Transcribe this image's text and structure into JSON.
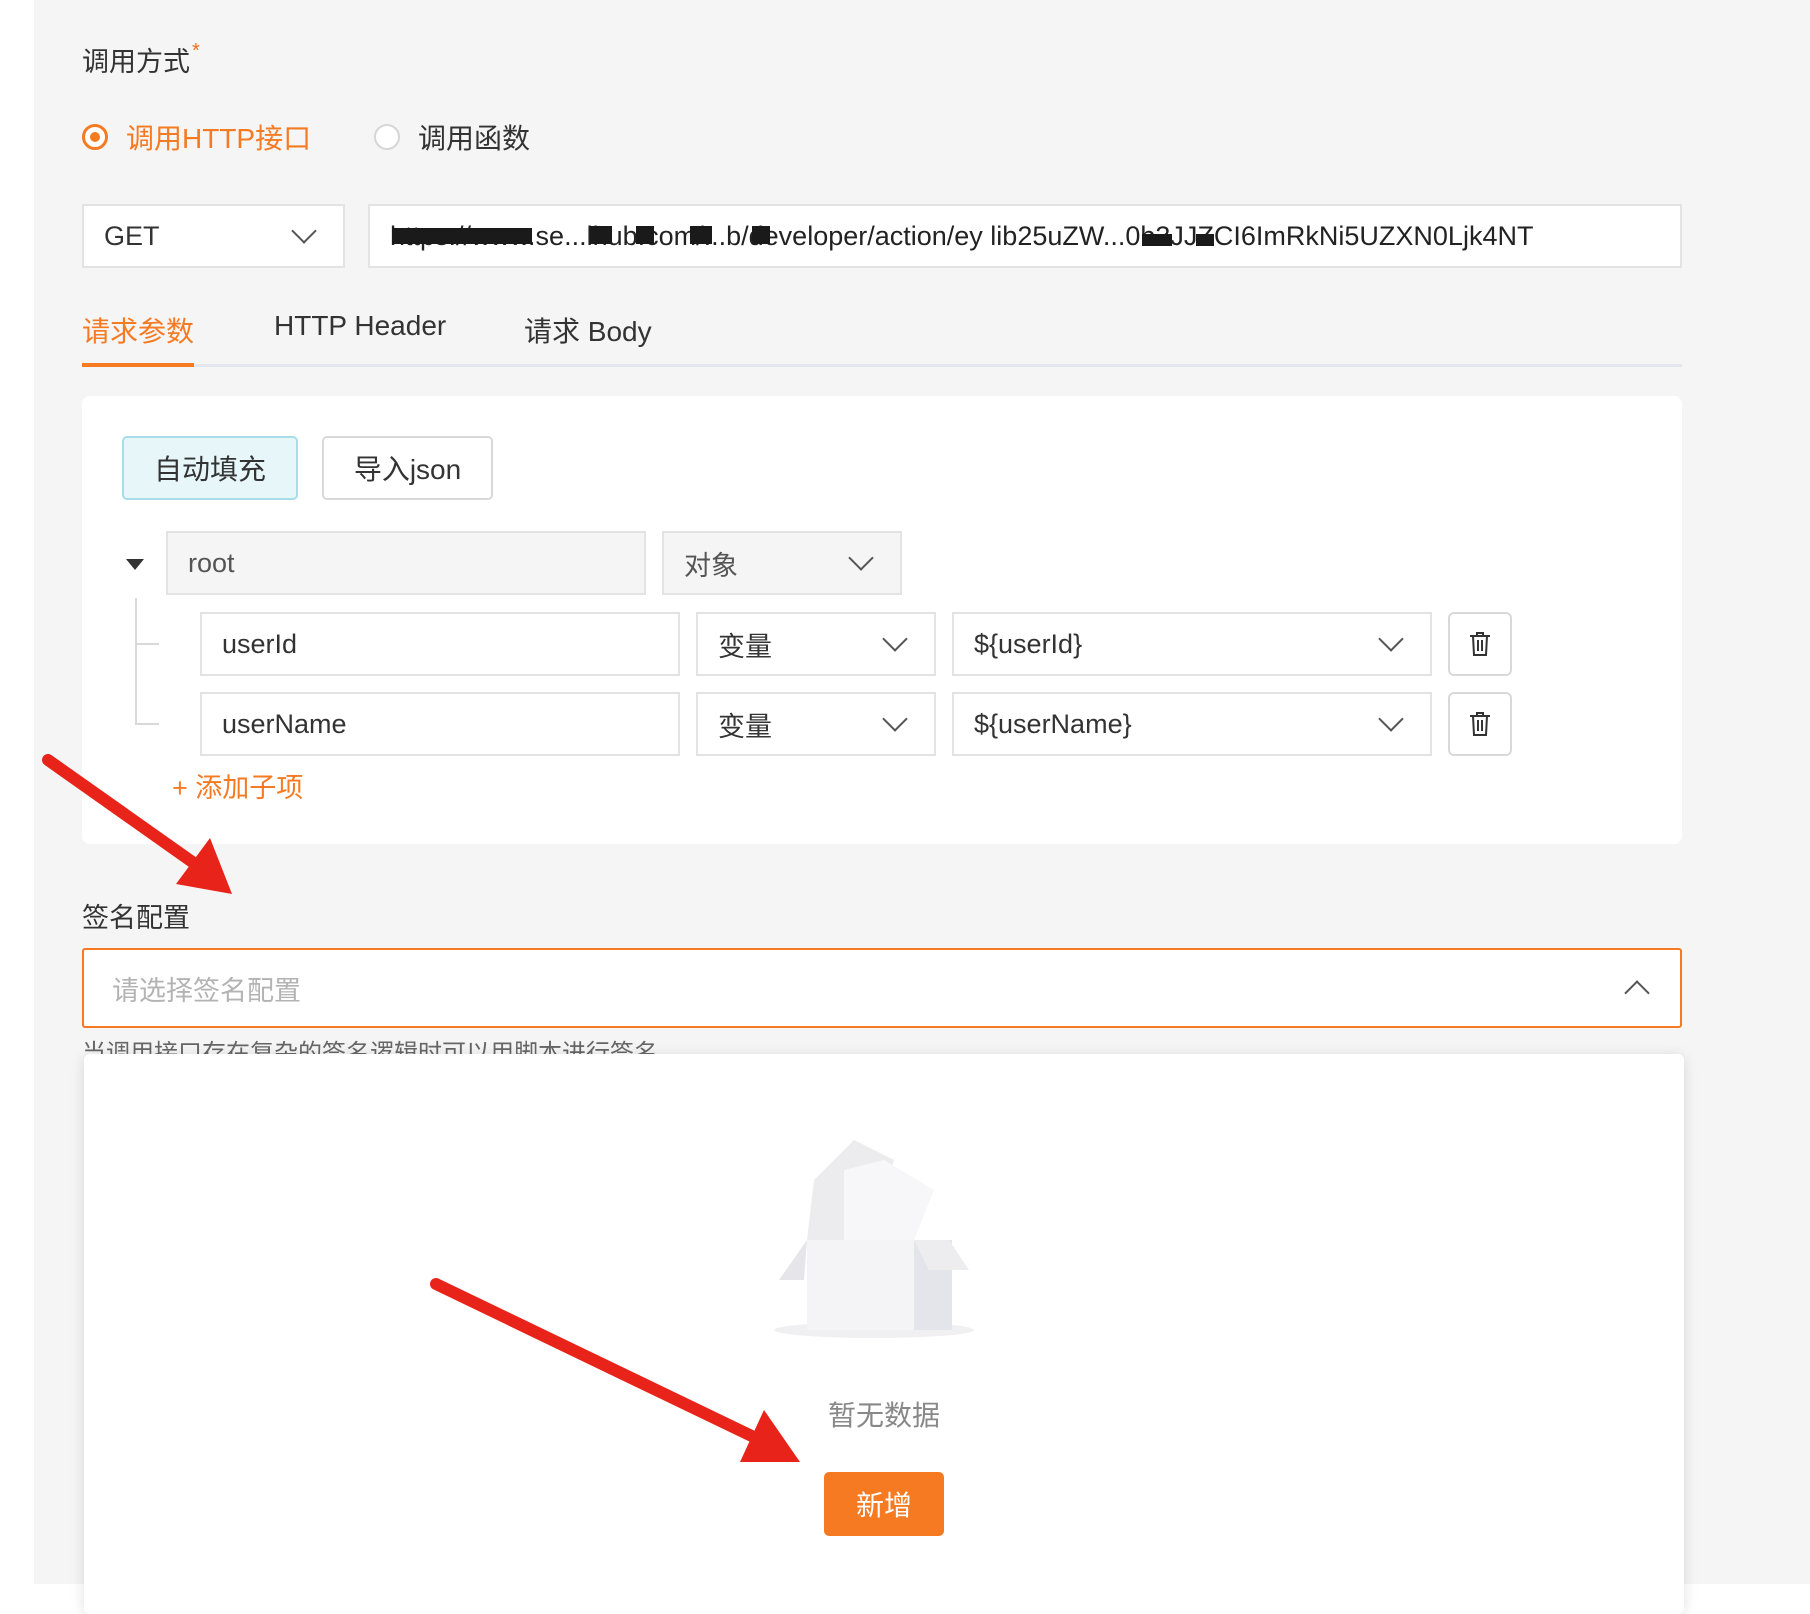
{
  "call_method": {
    "label": "调用方式",
    "required_mark": "*",
    "options": [
      {
        "label": "调用HTTP接口",
        "selected": true
      },
      {
        "label": "调用函数",
        "selected": false
      }
    ]
  },
  "request": {
    "method": "GET",
    "url": "https://www.se...lhub.com/...b/developer/action/ey lib25uZW...0b3JJZCI6ImRkNi5UZXN0Ljk4NT"
  },
  "tabs": [
    {
      "label": "请求参数",
      "active": true
    },
    {
      "label": "HTTP Header",
      "active": false
    },
    {
      "label": "请求 Body",
      "active": false
    }
  ],
  "params": {
    "auto_fill_label": "自动填充",
    "import_json_label": "导入json",
    "root": {
      "name": "root",
      "type": "对象"
    },
    "children": [
      {
        "name": "userId",
        "type": "变量",
        "value": "${userId}"
      },
      {
        "name": "userName",
        "type": "变量",
        "value": "${userName}"
      }
    ],
    "add_child_label": "+ 添加子项"
  },
  "signature": {
    "label": "签名配置",
    "placeholder": "请选择签名配置",
    "hint": "当调用接口存在复杂的签名逻辑时可以用脚本进行签名",
    "empty_text": "暂无数据",
    "new_button": "新增"
  },
  "colors": {
    "accent": "#f57a22",
    "arrow": "#e8231a"
  }
}
